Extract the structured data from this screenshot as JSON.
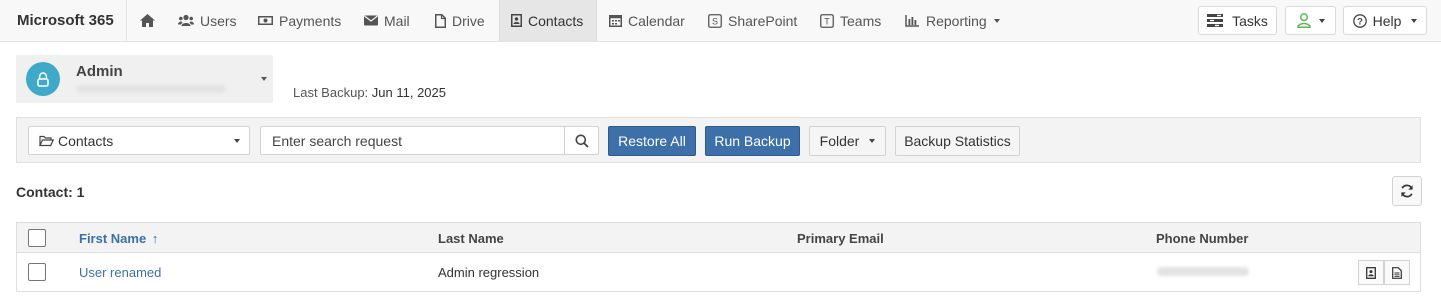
{
  "brand": "Microsoft 365",
  "nav": {
    "home_icon": "home-icon",
    "items": [
      {
        "label": "Users",
        "icon": "users-icon"
      },
      {
        "label": "Payments",
        "icon": "money-icon"
      },
      {
        "label": "Mail",
        "icon": "envelope-icon"
      },
      {
        "label": "Drive",
        "icon": "file-icon"
      },
      {
        "label": "Contacts",
        "icon": "contact-card-icon",
        "active": true
      },
      {
        "label": "Calendar",
        "icon": "calendar-icon"
      },
      {
        "label": "SharePoint",
        "icon": "sharepoint-icon"
      },
      {
        "label": "Teams",
        "icon": "teams-icon"
      },
      {
        "label": "Reporting",
        "icon": "bar-chart-icon",
        "dropdown": true
      }
    ],
    "tasks_label": "Tasks",
    "help_label": "Help",
    "user_icon": "user-icon"
  },
  "account": {
    "name": "Admin",
    "last_backup_label": "Last Backup:",
    "last_backup_value": "Jun 11, 2025"
  },
  "toolbar": {
    "folder_select_value": "Contacts",
    "search_placeholder": "Enter search request",
    "restore_all_label": "Restore All",
    "run_backup_label": "Run Backup",
    "folder_label": "Folder",
    "backup_statistics_label": "Backup Statistics"
  },
  "contact_count": "Contact: 1",
  "table": {
    "columns": [
      "First Name",
      "Last Name",
      "Primary Email",
      "Phone Number"
    ],
    "sort_indicator": "↑",
    "rows": [
      {
        "first_name": "User renamed",
        "last_name": "Admin regression",
        "primary_email": ""
      }
    ]
  },
  "colors": {
    "primary": "#3d6fa8",
    "avatar": "#3ea9c8",
    "status_green": "#5cb85c"
  }
}
